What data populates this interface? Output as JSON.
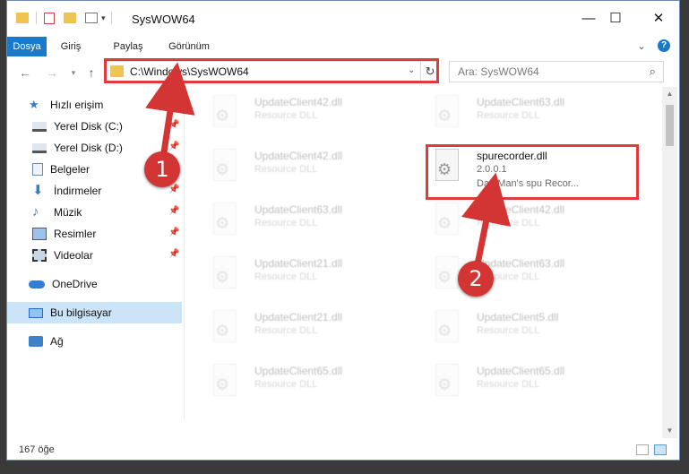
{
  "window": {
    "title": "SysWOW64",
    "minimize": "—",
    "maximize": "☐",
    "close": "✕"
  },
  "ribbon": {
    "tabs": [
      "Dosya",
      "Giriş",
      "Paylaş",
      "Görünüm"
    ],
    "collapse": "⌄",
    "help": "?"
  },
  "address": {
    "path": "C:\\Windows\\SysWOW64",
    "search_placeholder": "Ara: SysWOW64"
  },
  "nav": {
    "quick_access": "Hızlı erişim",
    "items": [
      {
        "label": "Yerel Disk (C:)",
        "icon": "drive-icon"
      },
      {
        "label": "Yerel Disk (D:)",
        "icon": "drive-icon"
      },
      {
        "label": "Belgeler",
        "icon": "documents-icon"
      },
      {
        "label": "İndirmeler",
        "icon": "downloads-icon"
      },
      {
        "label": "Müzik",
        "icon": "music-icon"
      },
      {
        "label": "Resimler",
        "icon": "pictures-icon"
      },
      {
        "label": "Videolar",
        "icon": "videos-icon"
      }
    ],
    "onedrive": "OneDrive",
    "this_pc": "Bu bilgisayar",
    "network": "Ağ"
  },
  "files": [
    {
      "name": "UpdateClient42.dll",
      "type": "Resource DLL"
    },
    {
      "name": "UpdateClient63.dll",
      "type": "Resource DLL"
    },
    {
      "name": "UpdateClient42.dll",
      "type": "Resource DLL"
    },
    {
      "name": "spurecorder.dll",
      "version": "2.0.0.1",
      "desc": "DarkMan's spu Recor..."
    },
    {
      "name": "UpdateClient63.dll",
      "type": "Resource DLL"
    },
    {
      "name": "UpdateClient42.dll",
      "type": "Resource DLL"
    },
    {
      "name": "UpdateClient21.dll",
      "type": "Resource DLL"
    },
    {
      "name": "UpdateClient63.dll",
      "type": "Resource DLL"
    },
    {
      "name": "UpdateClient21.dll",
      "type": "Resource DLL"
    },
    {
      "name": "UpdateClient5.dll",
      "type": "Resource DLL"
    },
    {
      "name": "UpdateClient65.dll",
      "type": "Resource DLL"
    },
    {
      "name": "UpdateClient65.dll",
      "type": "Resource DLL"
    }
  ],
  "status": {
    "count": "167 öğe"
  },
  "annotations": [
    "1",
    "2"
  ],
  "colors": {
    "accent": "#1979ca",
    "highlight": "#e23a3a",
    "selected": "#cce4f7"
  }
}
